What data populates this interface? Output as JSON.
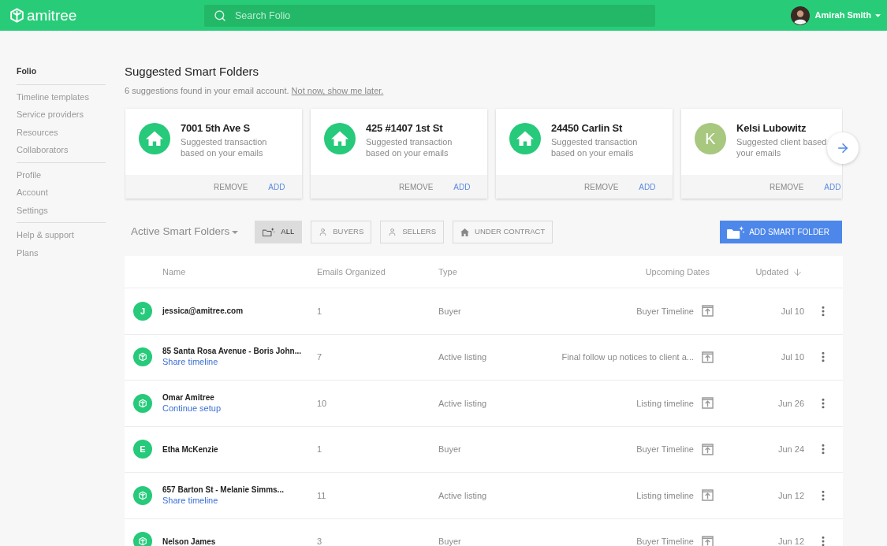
{
  "header": {
    "logo": "amitree",
    "search": {
      "placeholder": "Search Folio"
    },
    "user": {
      "name": "Amirah Smith"
    }
  },
  "sidebar": {
    "sections": [
      {
        "items": [
          {
            "label": "Folio",
            "selected": true
          }
        ]
      },
      {
        "items": [
          {
            "label": "Timeline templates",
            "selected": false
          },
          {
            "label": "Service providers",
            "selected": false
          },
          {
            "label": "Resources",
            "selected": false
          },
          {
            "label": "Collaborators",
            "selected": false
          }
        ]
      },
      {
        "items": [
          {
            "label": "Profile",
            "selected": false
          },
          {
            "label": "Account",
            "selected": false
          },
          {
            "label": "Settings",
            "selected": false
          }
        ]
      },
      {
        "items": [
          {
            "label": "Help & support",
            "selected": false
          },
          {
            "label": "Plans",
            "selected": false
          }
        ]
      }
    ]
  },
  "suggestions": {
    "title": "Suggested Smart Folders",
    "summary": "6 suggestions found in your email account.",
    "dismiss_link": "Not now, show me later.",
    "cards": [
      {
        "kind": "house",
        "color": "#27c97a",
        "title": "7001 5th Ave S",
        "description": [
          "Suggested transaction",
          "based on your emails"
        ],
        "remove": "REMOVE",
        "add": "ADD"
      },
      {
        "kind": "house",
        "color": "#27c97a",
        "title": "425 #1407 1st St",
        "description": [
          "Suggested transaction",
          "based on your emails"
        ],
        "remove": "REMOVE",
        "add": "ADD"
      },
      {
        "kind": "house",
        "color": "#27c97a",
        "title": "24450 Carlin St",
        "description": [
          "Suggested transaction",
          "based on your emails"
        ],
        "remove": "REMOVE",
        "add": "ADD"
      },
      {
        "kind": "letter",
        "letter": "K",
        "color": "#a8c77f",
        "title": "Kelsi Lubowitz",
        "description": [
          "Suggested client based",
          "your emails"
        ],
        "remove": "REMOVE",
        "add": "ADD"
      }
    ]
  },
  "filters": {
    "dropdown": "Active Smart Folders",
    "buttons": [
      {
        "label": "ALL",
        "kind": "all",
        "selected": true
      },
      {
        "label": "BUYERS",
        "kind": "buyer",
        "selected": false
      },
      {
        "label": "SELLERS",
        "kind": "seller",
        "selected": false
      },
      {
        "label": "UNDER CONTRACT",
        "kind": "contract",
        "selected": false
      }
    ],
    "add_button": "ADD SMART FOLDER"
  },
  "table": {
    "columns": [
      {
        "label": "Name",
        "sorted": false
      },
      {
        "label": "Emails Organized",
        "sorted": false
      },
      {
        "label": "Type",
        "sorted": false
      },
      {
        "label": "Upcoming Dates",
        "sorted": false
      },
      {
        "label": "Updated",
        "sorted": true
      }
    ],
    "rows": [
      {
        "kind": "letter",
        "letter": "J",
        "name": "jessica@amitree.com",
        "emails": "1",
        "type": "Buyer",
        "upcoming": "Buyer Timeline",
        "updated": "Jul 10"
      },
      {
        "kind": "logo",
        "name": "85 Santa Rosa Avenue - Boris John...",
        "link": "Share timeline",
        "emails": "7",
        "type": "Active listing",
        "upcoming": "Final follow up notices to client a...",
        "updated": "Jul 10"
      },
      {
        "kind": "logo",
        "name": "Omar Amitree",
        "link": "Continue setup",
        "emails": "10",
        "type": "Active listing",
        "upcoming": "Listing timeline",
        "updated": "Jun 26"
      },
      {
        "kind": "letter",
        "letter": "E",
        "name": "Etha McKenzie",
        "emails": "1",
        "type": "Buyer",
        "upcoming": "Buyer Timeline",
        "updated": "Jun 24"
      },
      {
        "kind": "logo",
        "name": "657 Barton St - Melanie Simms...",
        "link": "Share timeline",
        "emails": "11",
        "type": "Active listing",
        "upcoming": "Listing timeline",
        "updated": "Jun 12"
      },
      {
        "kind": "logo",
        "name": "Nelson James",
        "emails": "3",
        "type": "Buyer",
        "upcoming": "Buyer Timeline",
        "updated": "Jun 12"
      }
    ]
  }
}
